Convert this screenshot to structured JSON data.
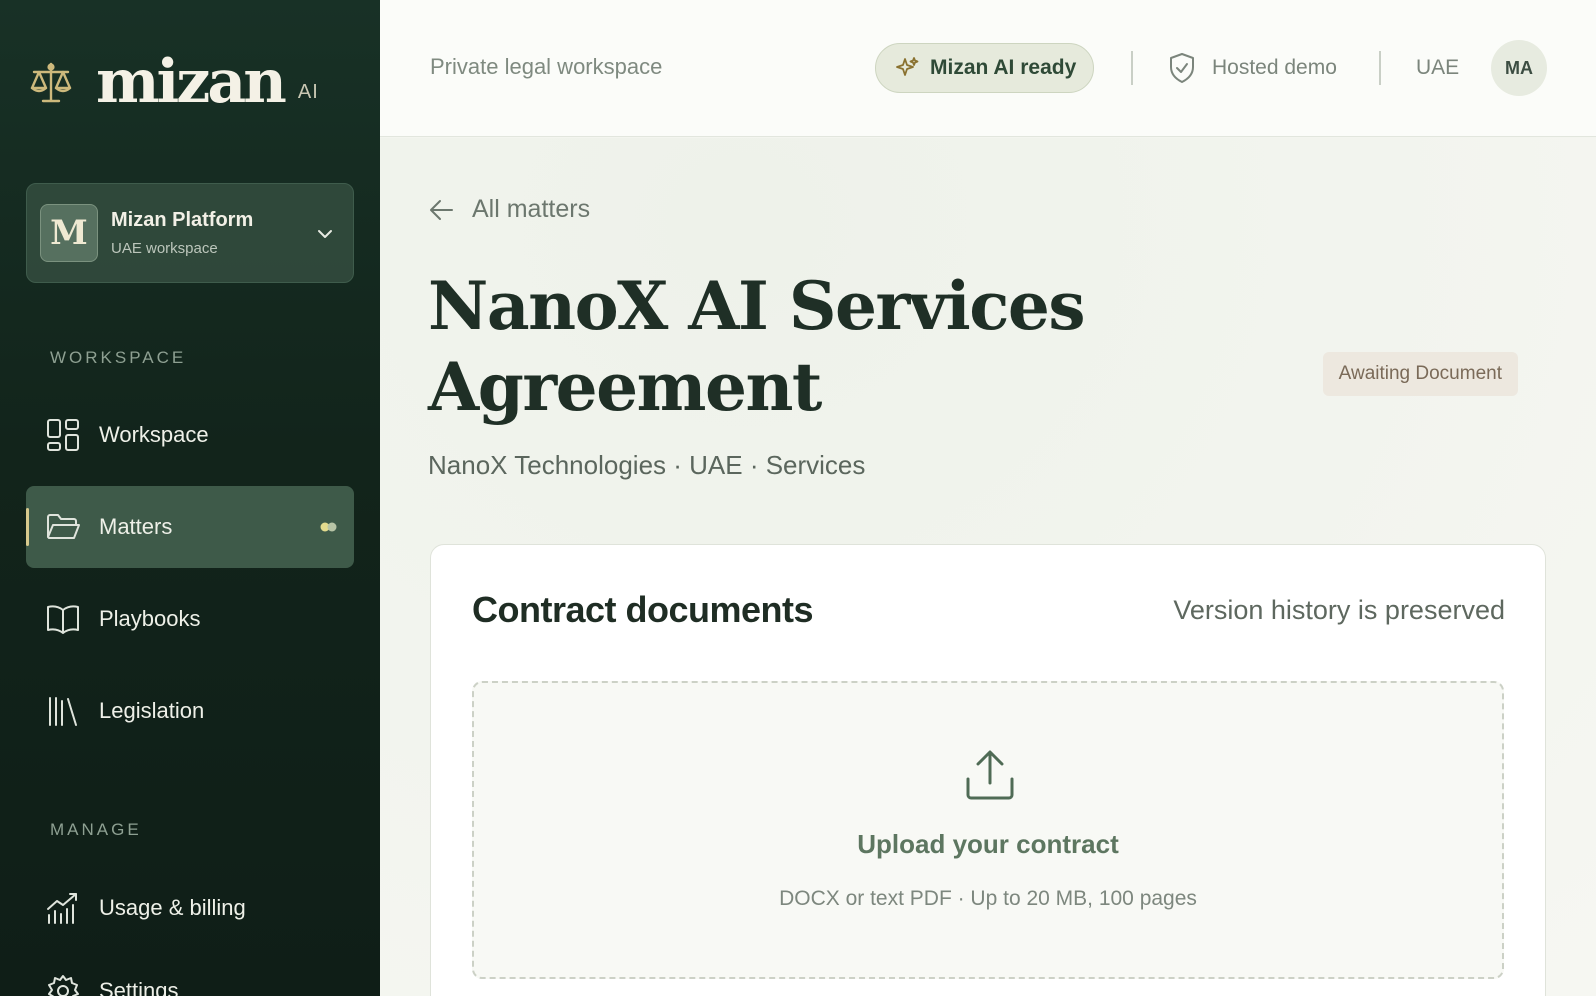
{
  "brand": {
    "name": "mizan",
    "suffix": "AI",
    "logo_icon": "scales-icon"
  },
  "org": {
    "initial": "M",
    "name": "Mizan Platform",
    "subtitle": "UAE workspace"
  },
  "sidebar": {
    "sections": [
      {
        "label": "WORKSPACE"
      },
      {
        "label": "MANAGE"
      }
    ],
    "items": [
      {
        "label": "Workspace",
        "icon": "grid-icon"
      },
      {
        "label": "Matters",
        "icon": "folder-icon",
        "active": true
      },
      {
        "label": "Playbooks",
        "icon": "book-icon"
      },
      {
        "label": "Legislation",
        "icon": "library-icon"
      },
      {
        "label": "Usage & billing",
        "icon": "chart-icon"
      },
      {
        "label": "Settings",
        "icon": "gear-icon"
      }
    ]
  },
  "topbar": {
    "tagline": "Private legal workspace",
    "ai_status": "Mizan AI ready",
    "hosting": "Hosted demo",
    "region": "UAE",
    "user_initials": "MA"
  },
  "matter": {
    "back_label": "All matters",
    "title": "NanoX AI Services Agreement",
    "status": "Awaiting Document",
    "subtitle": "NanoX Technologies · UAE · Services"
  },
  "documents": {
    "title": "Contract documents",
    "note": "Version history is preserved",
    "upload_title": "Upload your contract",
    "upload_hint": "DOCX or text PDF · Up to 20 MB, 100 pages"
  },
  "colors": {
    "sidebar_bg": "#12241b",
    "active_item": "#3e5a49",
    "accent_gold": "#d7c98d",
    "status_badge_bg": "#ede8df"
  }
}
